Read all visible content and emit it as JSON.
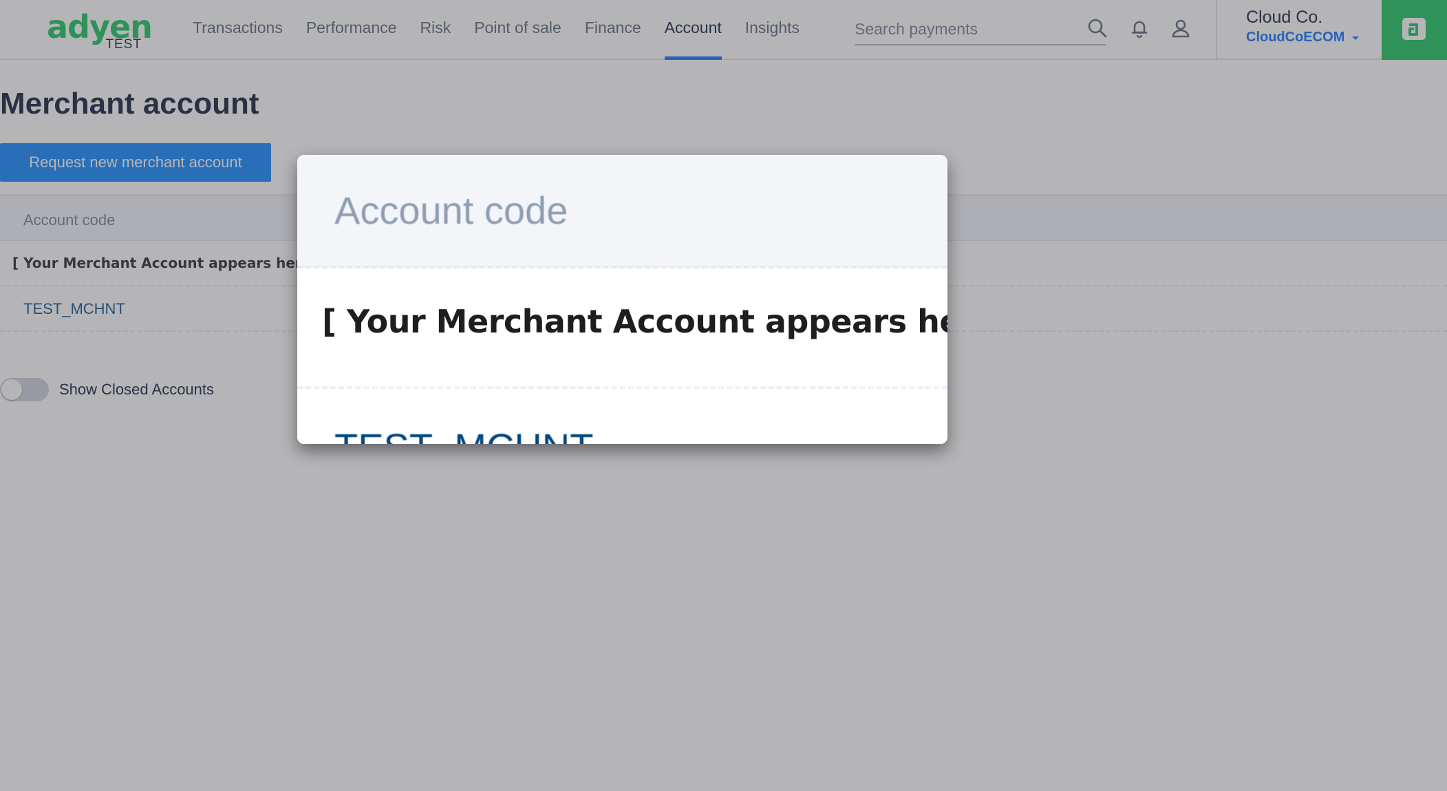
{
  "header": {
    "logo": {
      "word": "adyen",
      "environment": "TEST"
    },
    "nav": [
      {
        "label": "Transactions",
        "active": false
      },
      {
        "label": "Performance",
        "active": false
      },
      {
        "label": "Risk",
        "active": false
      },
      {
        "label": "Point of sale",
        "active": false
      },
      {
        "label": "Finance",
        "active": false
      },
      {
        "label": "Account",
        "active": true
      },
      {
        "label": "Insights",
        "active": false
      }
    ],
    "search": {
      "placeholder": "Search payments",
      "value": ""
    },
    "icons": [
      "search-icon",
      "bell-icon",
      "user-icon"
    ],
    "company": "Cloud Co.",
    "merchant": "CloudCoECOM",
    "accent_color": "#0abf53",
    "link_color": "#0066ff"
  },
  "page": {
    "title": "Merchant account",
    "request_button": "Request new merchant account",
    "table": {
      "column_header": "Account code",
      "rows": [
        "[ Your Merchant Account appears here ]",
        "TEST_MCHNT"
      ]
    },
    "toggle": {
      "label": "Show Closed Accounts",
      "on": false
    }
  },
  "magnifier": {
    "header": "Account code",
    "row1": "[ Your Merchant Account appears here ]",
    "row2": "TEST_MCHNT"
  }
}
